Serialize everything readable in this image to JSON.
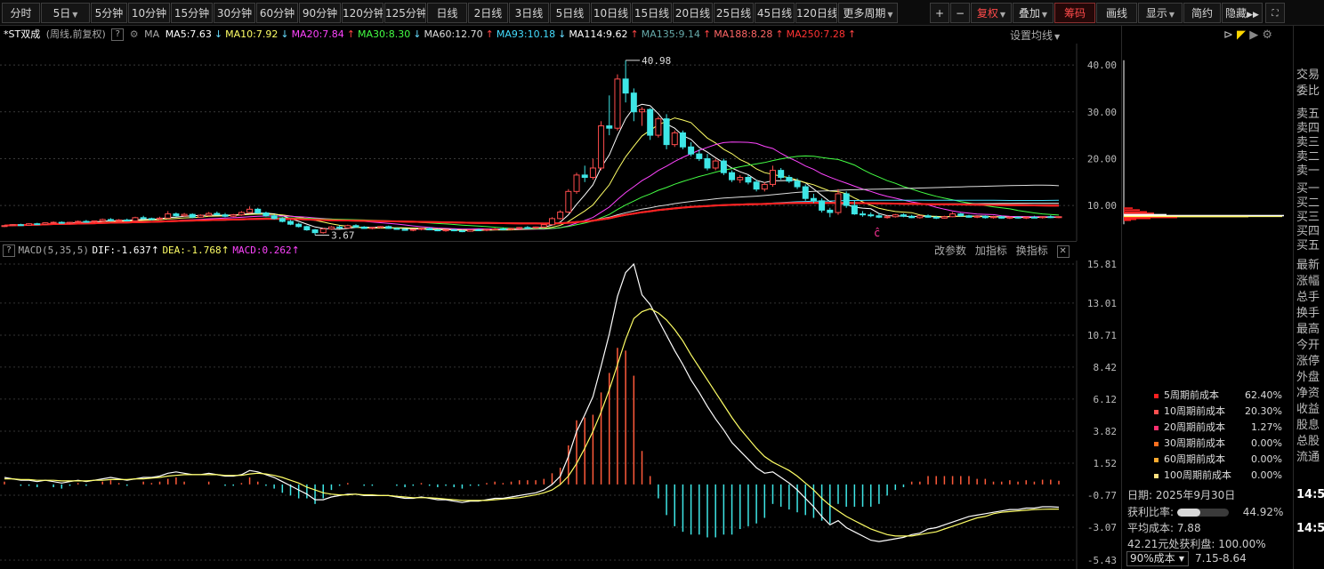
{
  "toolbar": {
    "periods": [
      "分时",
      "5日",
      "5分钟",
      "10分钟",
      "15分钟",
      "30分钟",
      "60分钟",
      "90分钟",
      "120分钟",
      "125分钟",
      "日线",
      "2日线",
      "3日线",
      "5日线",
      "10日线",
      "15日线",
      "20日线",
      "25日线",
      "45日线",
      "120日线",
      "更多周期"
    ],
    "right_buttons": {
      "plus": "+",
      "minus": "−",
      "fuquan": "复权",
      "diejia": "叠加",
      "chouma": "筹码",
      "huaxian": "画线",
      "xianshi": "显示",
      "jianyue": "简约",
      "yincang": "隐藏"
    }
  },
  "main_chart": {
    "stock_title": "*ST双成",
    "mode": "(周线,前复权)",
    "ma_label": "MA",
    "ma_items": [
      {
        "text": "MA5:7.63",
        "arrow": "↓",
        "color": "#ffffff"
      },
      {
        "text": "MA10:7.92",
        "arrow": "↓",
        "color": "#ffff66"
      },
      {
        "text": "MA20:7.84",
        "arrow": "↑",
        "color": "#ff44ff"
      },
      {
        "text": "MA30:8.30",
        "arrow": "↓",
        "color": "#44ff44"
      },
      {
        "text": "MA60:12.70",
        "arrow": "↑",
        "color": "#dddddd"
      },
      {
        "text": "MA93:10.18",
        "arrow": "↓",
        "color": "#44ddff"
      },
      {
        "text": "MA114:9.62",
        "arrow": "↑",
        "color": "#ffffff"
      },
      {
        "text": "MA135:9.14",
        "arrow": "↑",
        "color": "#66aaaa"
      },
      {
        "text": "MA188:8.28",
        "arrow": "↑",
        "color": "#ff6666"
      },
      {
        "text": "MA250:7.28",
        "arrow": "↑",
        "color": "#ff3333"
      }
    ],
    "settings_label": "设置均线",
    "y_labels": [
      "40.00",
      "30.00",
      "20.00",
      "10.00"
    ],
    "high_label": "40.98",
    "low_label": "3.67"
  },
  "macd": {
    "title": "MACD(5,35,5)",
    "dif": "DIF:-1.637",
    "dea": "DEA:-1.768",
    "macd": "MACD:0.262",
    "buttons": {
      "params": "改参数",
      "add": "加指标",
      "switch": "换指标"
    },
    "y_labels": [
      "15.81",
      "13.01",
      "10.71",
      "8.42",
      "6.12",
      "3.82",
      "1.52",
      "-0.77",
      "-3.07",
      "-5.43"
    ]
  },
  "chip_panel": {
    "legend": [
      {
        "label": "5周期前成本",
        "value": "62.40%",
        "color": "#ff2020"
      },
      {
        "label": "10周期前成本",
        "value": "20.30%",
        "color": "#ff5050"
      },
      {
        "label": "20周期前成本",
        "value": "1.27%",
        "color": "#ff3070"
      },
      {
        "label": "30周期前成本",
        "value": "0.00%",
        "color": "#ff7020"
      },
      {
        "label": "60周期前成本",
        "value": "0.00%",
        "color": "#ffaa30"
      },
      {
        "label": "100周期前成本",
        "value": "0.00%",
        "color": "#ffe080"
      }
    ],
    "date": "日期: 2025年9月30日",
    "profit_ratio_label": "获利比率:",
    "profit_ratio": 0.4492,
    "profit_ratio_text": "44.92%",
    "avg_cost": "平均成本: 7.88",
    "profit_line": "42.21元处获利盘: 100.00%",
    "cost_select": "90%成本",
    "cost_range": "7.15-8.64"
  },
  "right_quote": {
    "items": [
      "交易",
      "委比",
      "卖五",
      "卖四",
      "卖三",
      "卖二",
      "卖一",
      "买一",
      "买二",
      "买三",
      "买四",
      "买五",
      "最新",
      "涨幅",
      "总手",
      "换手",
      "最高",
      "今开",
      "涨停",
      "外盘",
      "净资",
      "收益",
      "股息",
      "总股",
      "流通"
    ],
    "times": [
      "14:5",
      "14:5"
    ]
  },
  "chart_data": {
    "type": "candlestick+macd",
    "price_y_range": [
      3,
      44
    ],
    "candles": [
      [
        5.6,
        5.8,
        5.4,
        5.7
      ],
      [
        5.7,
        6.0,
        5.6,
        5.9
      ],
      [
        5.9,
        6.1,
        5.7,
        5.8
      ],
      [
        5.8,
        6.2,
        5.7,
        6.1
      ],
      [
        6.1,
        6.3,
        5.9,
        6.0
      ],
      [
        6.0,
        6.4,
        5.9,
        6.3
      ],
      [
        6.3,
        6.6,
        6.1,
        6.4
      ],
      [
        6.4,
        6.6,
        6.1,
        6.2
      ],
      [
        6.2,
        6.5,
        6.0,
        6.4
      ],
      [
        6.4,
        6.8,
        6.3,
        6.6
      ],
      [
        6.6,
        6.9,
        6.3,
        6.5
      ],
      [
        6.5,
        6.8,
        6.2,
        6.7
      ],
      [
        6.7,
        7.2,
        6.5,
        7.0
      ],
      [
        7.0,
        7.3,
        6.6,
        6.8
      ],
      [
        6.8,
        7.1,
        6.5,
        6.9
      ],
      [
        6.9,
        7.2,
        6.6,
        6.7
      ],
      [
        6.7,
        7.6,
        6.6,
        7.4
      ],
      [
        7.4,
        7.8,
        7.0,
        7.2
      ],
      [
        7.2,
        7.4,
        6.8,
        7.1
      ],
      [
        7.1,
        7.6,
        6.9,
        7.3
      ],
      [
        7.3,
        8.8,
        7.1,
        8.2
      ],
      [
        8.2,
        8.5,
        7.6,
        7.8
      ],
      [
        7.8,
        8.4,
        7.6,
        8.1
      ],
      [
        8.1,
        8.3,
        7.3,
        7.5
      ],
      [
        7.5,
        8.1,
        7.4,
        7.9
      ],
      [
        7.9,
        8.6,
        7.7,
        8.3
      ],
      [
        8.3,
        8.7,
        7.9,
        8.0
      ],
      [
        8.0,
        8.4,
        7.5,
        7.7
      ],
      [
        7.7,
        8.2,
        7.5,
        8.0
      ],
      [
        8.0,
        8.8,
        7.8,
        8.5
      ],
      [
        8.5,
        9.8,
        8.3,
        9.2
      ],
      [
        9.2,
        9.5,
        8.2,
        8.4
      ],
      [
        8.4,
        8.7,
        7.6,
        7.8
      ],
      [
        7.8,
        8.1,
        7.0,
        7.2
      ],
      [
        7.2,
        7.5,
        6.4,
        6.6
      ],
      [
        6.6,
        6.9,
        5.8,
        6.0
      ],
      [
        6.0,
        6.3,
        5.3,
        5.5
      ],
      [
        5.5,
        5.7,
        4.6,
        4.8
      ],
      [
        4.8,
        5.0,
        3.67,
        4.2
      ],
      [
        4.2,
        5.2,
        4.0,
        5.0
      ],
      [
        5.0,
        5.6,
        4.8,
        5.4
      ],
      [
        5.4,
        5.8,
        5.0,
        5.2
      ],
      [
        5.2,
        5.9,
        5.1,
        5.7
      ],
      [
        5.7,
        6.0,
        5.2,
        5.4
      ],
      [
        5.4,
        5.6,
        5.0,
        5.1
      ],
      [
        5.1,
        5.4,
        4.9,
        5.3
      ],
      [
        5.3,
        5.6,
        5.1,
        5.5
      ],
      [
        5.5,
        5.7,
        5.0,
        5.1
      ],
      [
        5.1,
        5.3,
        4.8,
        4.9
      ],
      [
        4.9,
        5.1,
        4.6,
        4.7
      ],
      [
        4.7,
        5.0,
        4.5,
        4.9
      ],
      [
        4.9,
        5.2,
        4.7,
        5.1
      ],
      [
        5.1,
        5.3,
        4.7,
        4.8
      ],
      [
        4.8,
        5.0,
        4.5,
        4.6
      ],
      [
        4.6,
        4.9,
        4.4,
        4.8
      ],
      [
        4.8,
        5.0,
        4.5,
        4.6
      ],
      [
        4.6,
        4.8,
        4.3,
        4.5
      ],
      [
        4.5,
        4.9,
        4.4,
        4.8
      ],
      [
        4.8,
        5.1,
        4.6,
        4.7
      ],
      [
        4.7,
        5.0,
        4.5,
        4.9
      ],
      [
        4.9,
        5.2,
        4.7,
        5.0
      ],
      [
        5.0,
        5.3,
        4.8,
        4.9
      ],
      [
        4.9,
        5.2,
        4.7,
        5.1
      ],
      [
        5.1,
        5.4,
        4.9,
        5.3
      ],
      [
        5.3,
        5.6,
        5.0,
        5.2
      ],
      [
        5.2,
        5.5,
        5.0,
        5.4
      ],
      [
        5.4,
        6.0,
        5.2,
        5.9
      ],
      [
        5.9,
        7.5,
        5.8,
        7.2
      ],
      [
        7.2,
        9.0,
        7.0,
        8.6
      ],
      [
        8.6,
        13.5,
        8.4,
        13.0
      ],
      [
        13.0,
        17.0,
        12.5,
        16.5
      ],
      [
        16.5,
        18.5,
        15.0,
        16.0
      ],
      [
        16.0,
        20.0,
        15.5,
        18.0
      ],
      [
        18.0,
        28.0,
        17.5,
        27.0
      ],
      [
        27.0,
        33.5,
        25.0,
        26.5
      ],
      [
        26.5,
        38.0,
        26.0,
        37.0
      ],
      [
        37.0,
        40.98,
        32.0,
        34.0
      ],
      [
        34.0,
        35.0,
        28.0,
        30.0
      ],
      [
        30.0,
        31.0,
        27.0,
        30.5
      ],
      [
        30.5,
        30.8,
        24.0,
        25.0
      ],
      [
        25.0,
        29.0,
        24.5,
        28.5
      ],
      [
        28.5,
        29.5,
        22.0,
        23.0
      ],
      [
        23.0,
        26.0,
        22.5,
        25.5
      ],
      [
        25.5,
        26.0,
        22.0,
        22.5
      ],
      [
        22.5,
        23.5,
        20.5,
        21.0
      ],
      [
        21.0,
        22.0,
        19.5,
        20.0
      ],
      [
        20.0,
        21.0,
        17.5,
        18.0
      ],
      [
        18.0,
        20.0,
        17.5,
        19.5
      ],
      [
        19.5,
        20.0,
        16.5,
        17.0
      ],
      [
        17.0,
        17.5,
        15.0,
        15.5
      ],
      [
        15.5,
        16.5,
        14.8,
        16.0
      ],
      [
        16.0,
        16.5,
        14.5,
        15.0
      ],
      [
        15.0,
        15.5,
        13.0,
        13.5
      ],
      [
        13.5,
        15.0,
        13.0,
        14.5
      ],
      [
        14.5,
        18.5,
        14.0,
        17.5
      ],
      [
        17.5,
        18.0,
        15.5,
        16.0
      ],
      [
        16.0,
        16.5,
        14.8,
        15.2
      ],
      [
        15.2,
        15.8,
        13.5,
        14.0
      ],
      [
        14.0,
        14.5,
        11.0,
        11.5
      ],
      [
        11.5,
        12.5,
        10.5,
        11.0
      ],
      [
        11.0,
        11.5,
        8.5,
        9.0
      ],
      [
        9.0,
        9.5,
        7.5,
        8.5
      ],
      [
        8.5,
        13.5,
        8.0,
        12.5
      ],
      [
        12.5,
        13.0,
        9.5,
        10.0
      ],
      [
        10.0,
        11.0,
        8.0,
        8.2
      ],
      [
        8.2,
        8.8,
        7.6,
        8.0
      ],
      [
        8.0,
        8.5,
        7.5,
        7.8
      ],
      [
        7.8,
        8.4,
        7.3,
        7.5
      ],
      [
        7.5,
        8.0,
        7.2,
        7.6
      ],
      [
        7.6,
        8.2,
        7.4,
        8.0
      ],
      [
        8.0,
        8.3,
        7.5,
        7.7
      ],
      [
        7.7,
        8.0,
        7.3,
        7.4
      ],
      [
        7.4,
        7.9,
        7.2,
        7.8
      ],
      [
        7.8,
        8.1,
        7.4,
        7.5
      ],
      [
        7.5,
        7.8,
        7.1,
        7.3
      ],
      [
        7.3,
        7.8,
        7.2,
        7.6
      ],
      [
        7.6,
        8.6,
        7.5,
        8.2
      ],
      [
        8.2,
        8.4,
        7.6,
        7.8
      ],
      [
        7.8,
        8.0,
        7.4,
        7.5
      ],
      [
        7.5,
        7.9,
        7.3,
        7.7
      ],
      [
        7.7,
        7.9,
        7.2,
        7.4
      ],
      [
        7.4,
        7.8,
        7.2,
        7.6
      ],
      [
        7.6,
        7.8,
        7.2,
        7.3
      ],
      [
        7.3,
        7.7,
        7.1,
        7.5
      ],
      [
        7.5,
        7.7,
        7.2,
        7.4
      ],
      [
        7.4,
        7.7,
        7.1,
        7.5
      ],
      [
        7.5,
        7.8,
        7.3,
        7.4
      ],
      [
        7.4,
        7.7,
        7.2,
        7.6
      ],
      [
        7.6,
        7.9,
        7.3,
        7.5
      ],
      [
        7.5,
        7.7,
        7.3,
        7.6
      ]
    ],
    "macd_y_range": [
      -5.43,
      15.81
    ],
    "dif": [
      0.5,
      0.4,
      0.3,
      0.3,
      0.2,
      0.3,
      0.2,
      0.1,
      0.2,
      0.3,
      0.2,
      0.3,
      0.4,
      0.5,
      0.4,
      0.3,
      0.4,
      0.5,
      0.5,
      0.6,
      0.8,
      0.9,
      0.8,
      0.7,
      0.7,
      0.8,
      0.7,
      0.6,
      0.6,
      0.7,
      1.0,
      0.9,
      0.7,
      0.5,
      0.2,
      -0.1,
      -0.4,
      -0.7,
      -1.1,
      -1.1,
      -0.9,
      -0.8,
      -0.7,
      -0.7,
      -0.8,
      -0.8,
      -0.8,
      -0.8,
      -0.9,
      -1.0,
      -1.0,
      -0.9,
      -1.0,
      -1.1,
      -1.1,
      -1.2,
      -1.3,
      -1.2,
      -1.2,
      -1.1,
      -1.0,
      -1.0,
      -0.9,
      -0.8,
      -0.7,
      -0.6,
      -0.4,
      0.0,
      0.6,
      2.0,
      3.8,
      5.0,
      6.3,
      8.5,
      10.8,
      13.5,
      15.2,
      15.81,
      13.6,
      12.9,
      11.8,
      10.7,
      9.6,
      8.6,
      7.5,
      6.6,
      5.6,
      4.7,
      3.9,
      3.0,
      2.4,
      1.8,
      1.2,
      0.8,
      0.9,
      0.5,
      0.1,
      -0.4,
      -1.0,
      -1.6,
      -2.3,
      -2.9,
      -2.6,
      -3.1,
      -3.4,
      -3.7,
      -4.0,
      -4.1,
      -4.0,
      -3.9,
      -3.8,
      -3.6,
      -3.5,
      -3.2,
      -3.1,
      -2.9,
      -2.7,
      -2.5,
      -2.3,
      -2.2,
      -2.1,
      -2.0,
      -1.9,
      -1.8,
      -1.8,
      -1.7,
      -1.7,
      -1.6,
      -1.6,
      -1.637
    ],
    "dea": [
      0.4,
      0.4,
      0.35,
      0.35,
      0.3,
      0.3,
      0.3,
      0.25,
      0.25,
      0.25,
      0.25,
      0.3,
      0.3,
      0.35,
      0.35,
      0.35,
      0.4,
      0.4,
      0.45,
      0.5,
      0.6,
      0.65,
      0.7,
      0.7,
      0.7,
      0.7,
      0.7,
      0.65,
      0.65,
      0.65,
      0.75,
      0.8,
      0.75,
      0.65,
      0.5,
      0.3,
      0.1,
      -0.2,
      -0.4,
      -0.6,
      -0.7,
      -0.75,
      -0.75,
      -0.7,
      -0.75,
      -0.75,
      -0.8,
      -0.8,
      -0.85,
      -0.9,
      -0.95,
      -0.95,
      -0.95,
      -1.0,
      -1.05,
      -1.1,
      -1.15,
      -1.15,
      -1.15,
      -1.15,
      -1.1,
      -1.05,
      -1.0,
      -0.95,
      -0.85,
      -0.75,
      -0.6,
      -0.4,
      0.0,
      0.6,
      1.5,
      2.6,
      3.8,
      5.2,
      6.8,
      8.6,
      10.4,
      11.9,
      12.4,
      12.6,
      12.3,
      11.8,
      11.1,
      10.3,
      9.3,
      8.4,
      7.5,
      6.6,
      5.7,
      4.8,
      4.0,
      3.3,
      2.6,
      2.0,
      1.6,
      1.3,
      1.0,
      0.6,
      0.1,
      -0.4,
      -1.0,
      -1.5,
      -1.9,
      -2.3,
      -2.6,
      -2.9,
      -3.2,
      -3.4,
      -3.6,
      -3.7,
      -3.7,
      -3.7,
      -3.6,
      -3.5,
      -3.4,
      -3.2,
      -3.0,
      -2.8,
      -2.6,
      -2.4,
      -2.3,
      -2.1,
      -2.0,
      -1.95,
      -1.9,
      -1.85,
      -1.8,
      -1.78,
      -1.77,
      -1.768
    ],
    "hist": [
      0.1,
      0.0,
      -0.05,
      -0.05,
      -0.1,
      0.0,
      -0.1,
      -0.15,
      -0.05,
      0.05,
      -0.05,
      0.0,
      0.1,
      0.15,
      0.05,
      -0.05,
      0.0,
      0.1,
      0.05,
      0.1,
      0.2,
      0.25,
      0.1,
      0.0,
      0.0,
      0.1,
      0.0,
      -0.05,
      -0.05,
      0.05,
      0.25,
      0.1,
      -0.05,
      -0.15,
      -0.3,
      -0.4,
      -0.5,
      -0.5,
      -0.7,
      -0.5,
      -0.2,
      -0.05,
      0.05,
      0.0,
      -0.05,
      -0.05,
      0.0,
      0.0,
      -0.05,
      -0.1,
      -0.05,
      0.05,
      -0.05,
      -0.1,
      -0.05,
      -0.1,
      -0.15,
      -0.05,
      -0.05,
      0.05,
      0.1,
      0.05,
      0.1,
      0.15,
      0.15,
      0.15,
      0.2,
      0.4,
      0.6,
      1.4,
      2.3,
      2.4,
      2.5,
      3.3,
      4.0,
      4.9,
      4.8,
      3.9,
      1.2,
      0.3,
      -0.5,
      -1.1,
      -1.5,
      -1.7,
      -1.8,
      -1.8,
      -1.9,
      -1.9,
      -1.8,
      -1.8,
      -1.6,
      -1.5,
      -1.4,
      -1.2,
      -0.7,
      -0.8,
      -0.9,
      -1.0,
      -1.1,
      -1.2,
      -1.3,
      -1.4,
      -0.7,
      -0.8,
      -0.8,
      -0.8,
      -0.8,
      -0.7,
      -0.4,
      -0.2,
      -0.1,
      0.1,
      0.1,
      0.3,
      0.3,
      0.3,
      0.3,
      0.3,
      0.3,
      0.2,
      0.2,
      0.1,
      0.1,
      0.15,
      0.1,
      0.15,
      0.1,
      0.17,
      0.17,
      0.131
    ]
  }
}
